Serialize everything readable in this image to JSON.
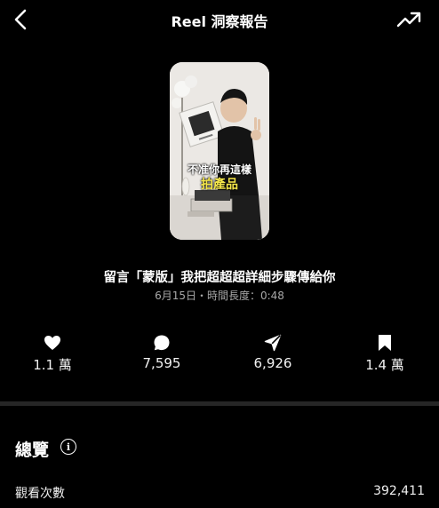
{
  "header": {
    "title": "Reel 洞察報告",
    "back_icon": "chevron-left-icon",
    "trend_icon": "trending-up-icon"
  },
  "thumbnail": {
    "text_line1": "不准你再這樣",
    "text_line2": "拍產品"
  },
  "reel": {
    "title": "留言「蒙版」我把超超超詳細步驟傳給你",
    "meta": "6月15日・時間長度：0:48"
  },
  "stats": [
    {
      "icon": "heart-icon",
      "value": "1.1 萬"
    },
    {
      "icon": "comment-icon",
      "value": "7,595"
    },
    {
      "icon": "share-icon",
      "value": "6,926"
    },
    {
      "icon": "bookmark-icon",
      "value": "1.4 萬"
    }
  ],
  "overview": {
    "title": "總覽",
    "info_icon": "info-icon",
    "rows": [
      {
        "label": "觀看次數",
        "value": "392,411"
      }
    ]
  }
}
